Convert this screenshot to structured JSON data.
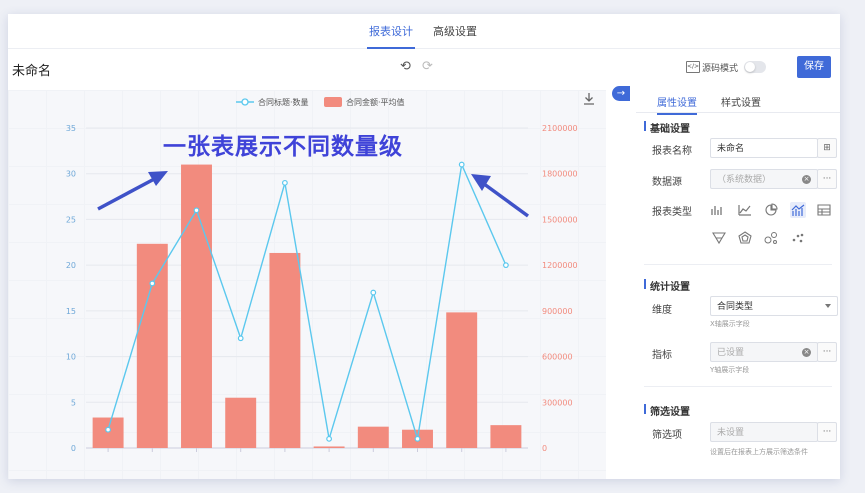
{
  "top_tabs": [
    "报表设计",
    "高级设置"
  ],
  "toolbar": {
    "title": "未命名",
    "source_mode_label": "源码模式",
    "save_label": "保存"
  },
  "headline": "一张表展示不同数量级",
  "panel": {
    "tabs": [
      "属性设置",
      "样式设置"
    ],
    "basic_section": "基础设置",
    "name_label": "报表名称",
    "name_value": "未命名",
    "datasource_label": "数据源",
    "datasource_value": "（系统数据）",
    "type_label": "报表类型",
    "stats_section": "统计设置",
    "dimension_label": "维度",
    "dimension_value": "合同类型",
    "dimension_hint": "X轴展示字段",
    "metric_label": "指标",
    "metric_value": "已设置",
    "metric_hint": "Y轴展示字段",
    "filter_section": "筛选设置",
    "filter_label": "筛选项",
    "filter_value": "未设置",
    "filter_hint": "设置后在报表上方展示筛选条件",
    "more": "···"
  },
  "colors": {
    "accent": "#3f6ad8",
    "bar": "#f28b7e",
    "line": "#5bc8ee",
    "arrow": "#3f52c8"
  },
  "chart_data": {
    "type": "bar+line",
    "legend": [
      "合同标题·数量",
      "合同金额·平均值"
    ],
    "legend_placement": "top-center",
    "series": [
      {
        "name": "合同标题·数量",
        "type": "line",
        "axis": "left",
        "values": [
          2,
          18,
          26,
          12,
          29,
          1,
          17,
          1,
          31,
          20
        ]
      },
      {
        "name": "合同金额·平均值",
        "type": "bar",
        "axis": "right",
        "values": [
          200000,
          1340000,
          1860000,
          330000,
          1280000,
          10000,
          140000,
          120000,
          890000,
          150000
        ]
      }
    ],
    "left_axis": {
      "ticks": [
        0,
        5,
        10,
        15,
        20,
        25,
        30,
        35
      ],
      "ylim": [
        0,
        35
      ]
    },
    "right_axis": {
      "ticks": [
        0,
        300000,
        600000,
        900000,
        1200000,
        1500000,
        1800000,
        2100000
      ],
      "ylim": [
        0,
        2100000
      ]
    },
    "grid": true
  }
}
